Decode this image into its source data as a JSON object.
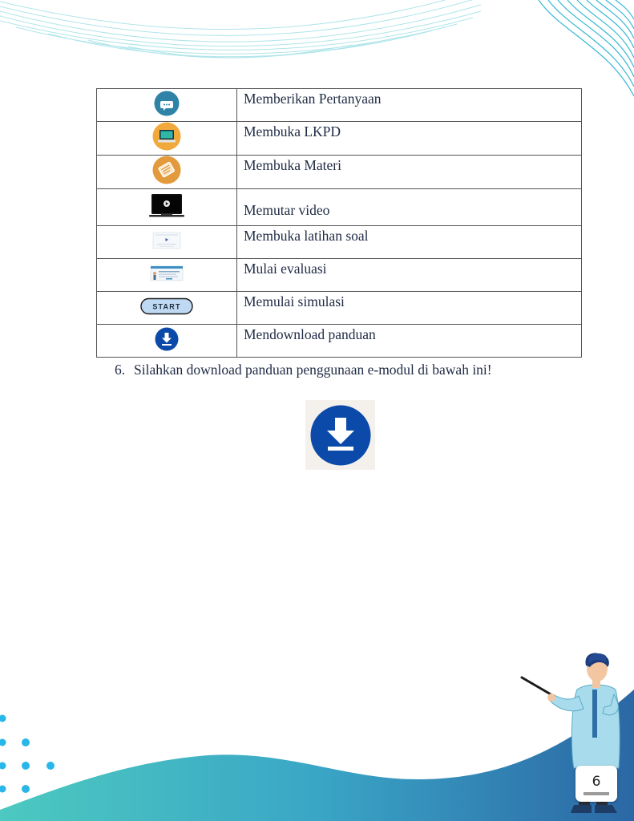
{
  "table": {
    "rows": [
      {
        "icon": "chat-bubble-icon",
        "label": "Memberikan Pertanyaan"
      },
      {
        "icon": "laptop-icon",
        "label": "Membuka LKPD"
      },
      {
        "icon": "book-icon",
        "label": "Membuka Materi"
      },
      {
        "icon": "video-screen-icon",
        "label": "Memutar video"
      },
      {
        "icon": "quiz-thumbnail-icon",
        "label": "Membuka latihan soal"
      },
      {
        "icon": "evaluation-thumbnail-icon",
        "label": "Mulai evaluasi"
      },
      {
        "icon": "start-button-icon",
        "label": "Memulai simulasi",
        "button_text": "START"
      },
      {
        "icon": "download-icon",
        "label": "Mendownload panduan"
      }
    ]
  },
  "instruction": {
    "number": "6.",
    "text": "Silahkan download panduan penggunaan e-modul di bawah ini!"
  },
  "download_button": {
    "icon": "download-icon",
    "color": "#0b4aa8"
  },
  "page_number": "6",
  "colors": {
    "wave_top": "#4ec3cf",
    "wave_teal": "#3fc1c0",
    "wave_blue": "#2c6fa8",
    "dots": "#29b6e8"
  }
}
